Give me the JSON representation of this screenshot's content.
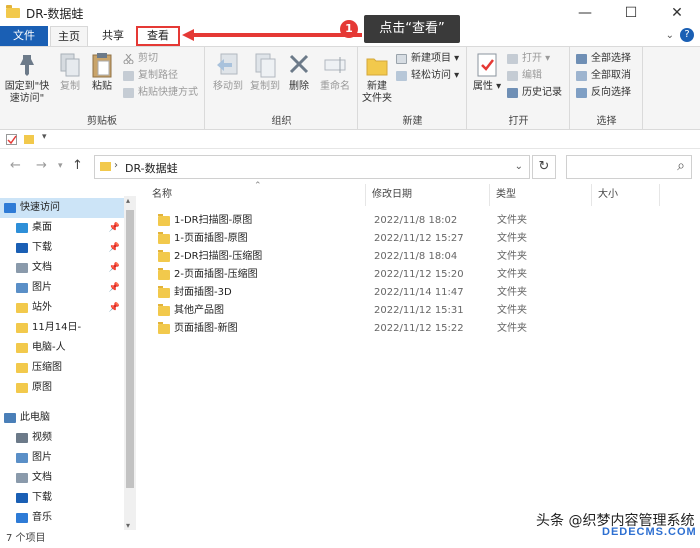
{
  "window": {
    "title": "DR-数据蛙",
    "minimize": "—",
    "maximize": "☐",
    "close": "✕"
  },
  "tabs": {
    "file": "文件",
    "home": "主页",
    "share": "共享",
    "view": "查看",
    "collapse": "⌄",
    "help": "?"
  },
  "annotation": {
    "step": "1",
    "tip": "点击“查看”"
  },
  "ribbon": {
    "clipboard": {
      "label": "剪贴板",
      "pin": "固定到\"快速访问\"",
      "copy": "复制",
      "paste": "粘贴",
      "cut": "剪切",
      "copy_path": "复制路径",
      "paste_shortcut": "粘贴快捷方式"
    },
    "organize": {
      "label": "组织",
      "move_to": "移动到",
      "copy_to": "复制到",
      "delete": "删除",
      "rename": "重命名"
    },
    "new": {
      "label": "新建",
      "new_folder": "新建\n文件夹",
      "new_item": "新建项目",
      "easy_access": "轻松访问"
    },
    "open": {
      "label": "打开",
      "properties": "属性",
      "open": "打开",
      "edit": "编辑",
      "history": "历史记录"
    },
    "select": {
      "label": "选择",
      "select_all": "全部选择",
      "select_none": "全部取消",
      "invert": "反向选择"
    }
  },
  "address": {
    "path": "DR-数据蛙",
    "refresh": "↻",
    "search_icon": "⌕"
  },
  "nav": {
    "items": [
      {
        "label": "快速访问",
        "pinned": false
      },
      {
        "label": "桌面",
        "pinned": true
      },
      {
        "label": "下载",
        "pinned": true
      },
      {
        "label": "文档",
        "pinned": true
      },
      {
        "label": "图片",
        "pinned": true
      },
      {
        "label": "站外",
        "pinned": true
      },
      {
        "label": "11月14日-",
        "pinned": false
      },
      {
        "label": "电脑-人",
        "pinned": false
      },
      {
        "label": "压缩图",
        "pinned": false
      },
      {
        "label": "原图",
        "pinned": false
      },
      {
        "label": "此电脑",
        "pinned": false
      },
      {
        "label": "视频",
        "pinned": false
      },
      {
        "label": "图片",
        "pinned": false
      },
      {
        "label": "文档",
        "pinned": false
      },
      {
        "label": "下载",
        "pinned": false
      },
      {
        "label": "音乐",
        "pinned": false
      }
    ]
  },
  "columns": {
    "name": "名称",
    "date": "修改日期",
    "type": "类型",
    "size": "大小"
  },
  "files": [
    {
      "name": "1-DR扫描图-原图",
      "date": "2022/11/8 18:02",
      "type": "文件夹"
    },
    {
      "name": "1-页面插图-原图",
      "date": "2022/11/12 15:27",
      "type": "文件夹"
    },
    {
      "name": "2-DR扫描图-压缩图",
      "date": "2022/11/8 18:04",
      "type": "文件夹"
    },
    {
      "name": "2-页面插图-压缩图",
      "date": "2022/11/12 15:20",
      "type": "文件夹"
    },
    {
      "name": "封面插图-3D",
      "date": "2022/11/14 11:47",
      "type": "文件夹"
    },
    {
      "name": "其他产品图",
      "date": "2022/11/12 15:31",
      "type": "文件夹"
    },
    {
      "name": "页面插图-新图",
      "date": "2022/11/12 15:22",
      "type": "文件夹"
    }
  ],
  "status": {
    "count": "7 个项目"
  },
  "watermark": {
    "main": "头条 @织梦内容管理系统",
    "sub": "DEDECMS.COM"
  },
  "colors": {
    "accent": "#1a5fb4",
    "highlight": "#e53935",
    "folder": "#f2c94c",
    "selection": "#cce4f7"
  }
}
